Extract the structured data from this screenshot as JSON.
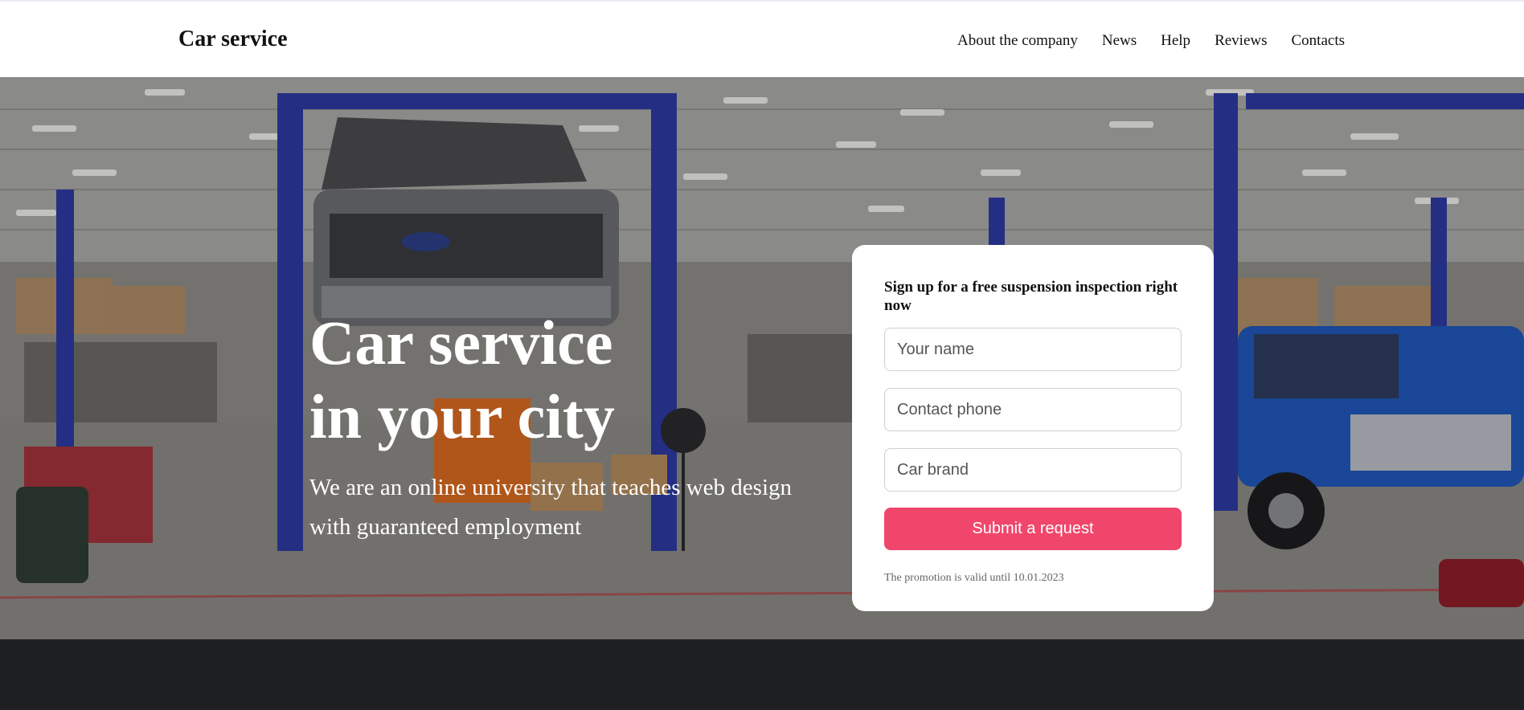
{
  "header": {
    "logo": "Car service",
    "nav": [
      "About the company",
      "News",
      "Help",
      "Reviews",
      "Contacts"
    ]
  },
  "hero": {
    "title_line1": "Car service",
    "title_line2": "in your city",
    "subtitle": "We are an online university that teaches web design with guaranteed employment"
  },
  "form": {
    "title": "Sign up for a free suspension inspection right now",
    "name_placeholder": "Your name",
    "phone_placeholder": "Contact phone",
    "brand_placeholder": "Car brand",
    "submit_label": "Submit a request",
    "promo": "The promotion is valid until 10.01.2023"
  },
  "colors": {
    "accent": "#f0466b",
    "lift_blue": "#2c3aa0"
  }
}
